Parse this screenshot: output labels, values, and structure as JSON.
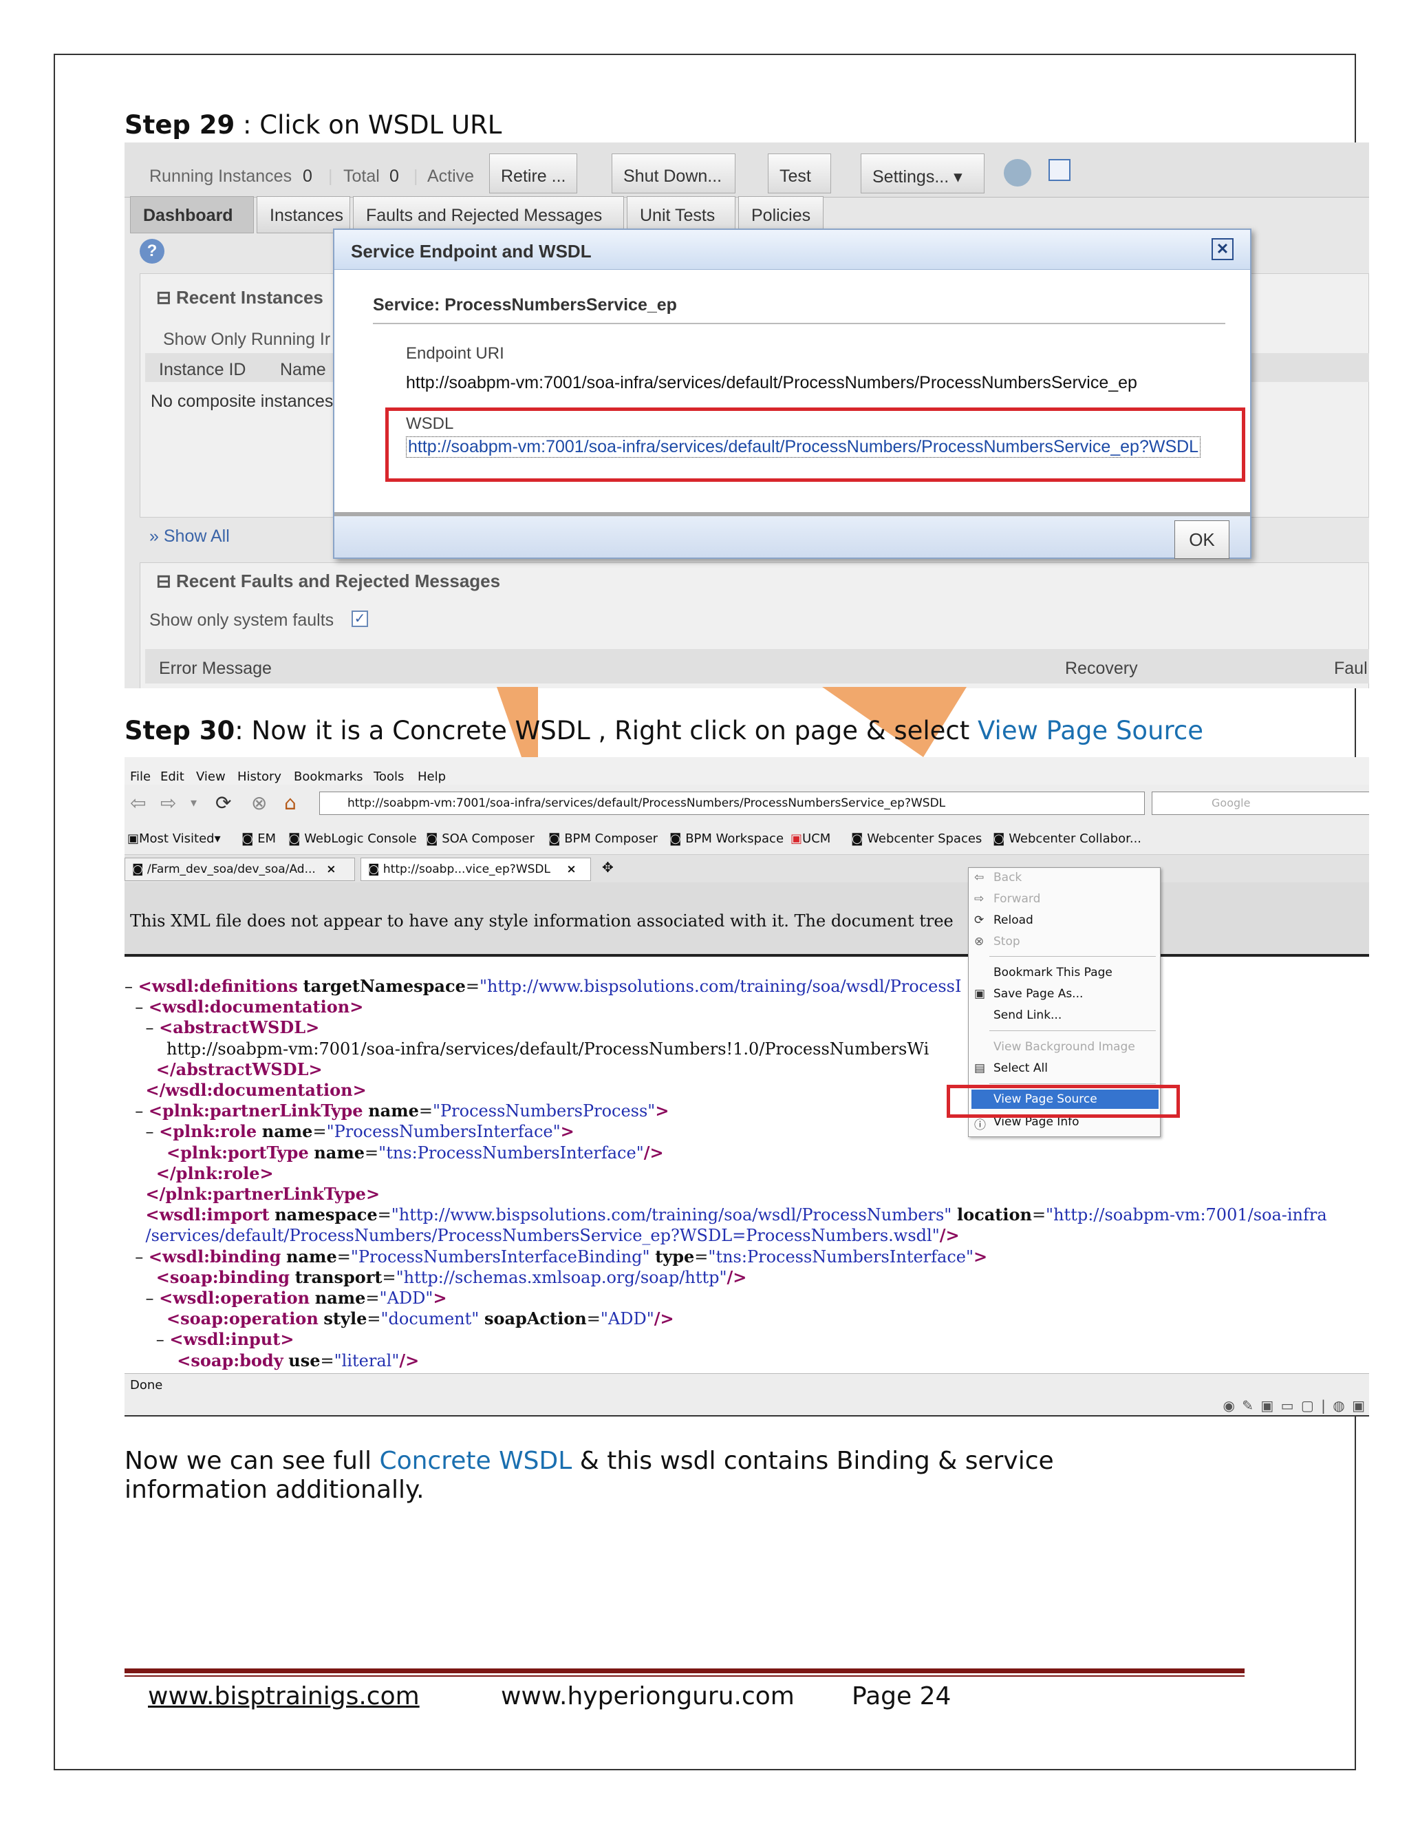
{
  "step29": {
    "label": "Step 29",
    "text": " : Click on WSDL URL"
  },
  "em": {
    "toolbar": {
      "running_instances": "Running Instances",
      "running_count": "0",
      "total": "Total",
      "total_count": "0",
      "active": "Active",
      "retire": "Retire ...",
      "shutdown": "Shut Down...",
      "test": "Test",
      "settings": "Settings..."
    },
    "tabs": [
      "Dashboard",
      "Instances",
      "Faults and Rejected Messages",
      "Unit Tests",
      "Policies"
    ],
    "recent_instances": "Recent Instances",
    "show_only_running": "Show Only Running Ir",
    "instance_id": "Instance ID",
    "name": "Name",
    "no_instances": "No composite instances",
    "show_all": "Show All",
    "recent_faults": "Recent Faults and Rejected Messages",
    "show_system_faults": "Show only system faults",
    "error_message": "Error Message",
    "recovery": "Recovery",
    "fault_col": "Faul",
    "dialog": {
      "title": "Service Endpoint and WSDL",
      "service": "Service: ProcessNumbersService_ep",
      "endpoint_label": "Endpoint URI",
      "endpoint_value": "http://soabpm-vm:7001/soa-infra/services/default/ProcessNumbers/ProcessNumbersService_ep",
      "wsdl_label": "WSDL",
      "wsdl_link": "http://soabpm-vm:7001/soa-infra/services/default/ProcessNumbers/ProcessNumbersService_ep?WSDL",
      "ok": "OK"
    }
  },
  "step30": {
    "label": "Step 30",
    "text": ": Now it is a Concrete WSDL , Right click on page & select ",
    "link": "View Page Source"
  },
  "browser": {
    "menus": [
      "File",
      "Edit",
      "View",
      "History",
      "Bookmarks",
      "Tools",
      "Help"
    ],
    "url": "http://soabpm-vm:7001/soa-infra/services/default/ProcessNumbers/ProcessNumbersService_ep?WSDL",
    "search_placeholder": "Google",
    "bookmarks": [
      "Most Visited",
      "EM",
      "WebLogic Console",
      "SOA Composer",
      "BPM Composer",
      "BPM Workspace",
      "UCM",
      "Webcenter Spaces",
      "Webcenter Collabor..."
    ],
    "tabs": [
      "/Farm_dev_soa/dev_soa/Ad...",
      "http://soabp...vice_ep?WSDL"
    ],
    "xml_notice": "This XML file does not appear to have any style information associated with it. The document tree",
    "status": "Done",
    "context_menu": [
      "Back",
      "Forward",
      "Reload",
      "Stop",
      "Bookmark This Page",
      "Save Page As...",
      "Send Link...",
      "View Background Image",
      "Select All",
      "View Page Source",
      "View Page Info"
    ],
    "xml": {
      "l1_ns": "http://www.bispsolutions.com/training/soa/wsdl/ProcessI",
      "l4_text": "http://soabpm-vm:7001/soa-infra/services/default/ProcessNumbers!1.0/ProcessNumbersWi",
      "plt_name": "ProcessNumbersProcess",
      "role_name": "ProcessNumbersInterface",
      "porttype_name": "tns:ProcessNumbersInterface",
      "import_ns": "http://www.bispsolutions.com/training/soa/wsdl/ProcessNumbers",
      "import_loc1": "http://soabpm-vm:7001/soa-infra",
      "import_loc2": "/services/default/ProcessNumbers/ProcessNumbersService_ep?WSDL=ProcessNumbers.wsdl",
      "binding_name": "ProcessNumbersInterfaceBinding",
      "binding_type": "tns:ProcessNumbersInterface",
      "transport": "http://schemas.xmlsoap.org/soap/http",
      "op_name": "ADD",
      "style": "document",
      "soap_action": "ADD",
      "use": "literal"
    }
  },
  "summary": {
    "p1": "Now  we  can  see   full ",
    "link": "Concrete  WSDL",
    "p2": "  &  this  wsdl  contains  Binding  &  service",
    "line2": "information additionally."
  },
  "footer": {
    "site1": "www.bisptrainigs.com",
    "site2": "www.hyperionguru.com",
    "page": "Page 24"
  }
}
